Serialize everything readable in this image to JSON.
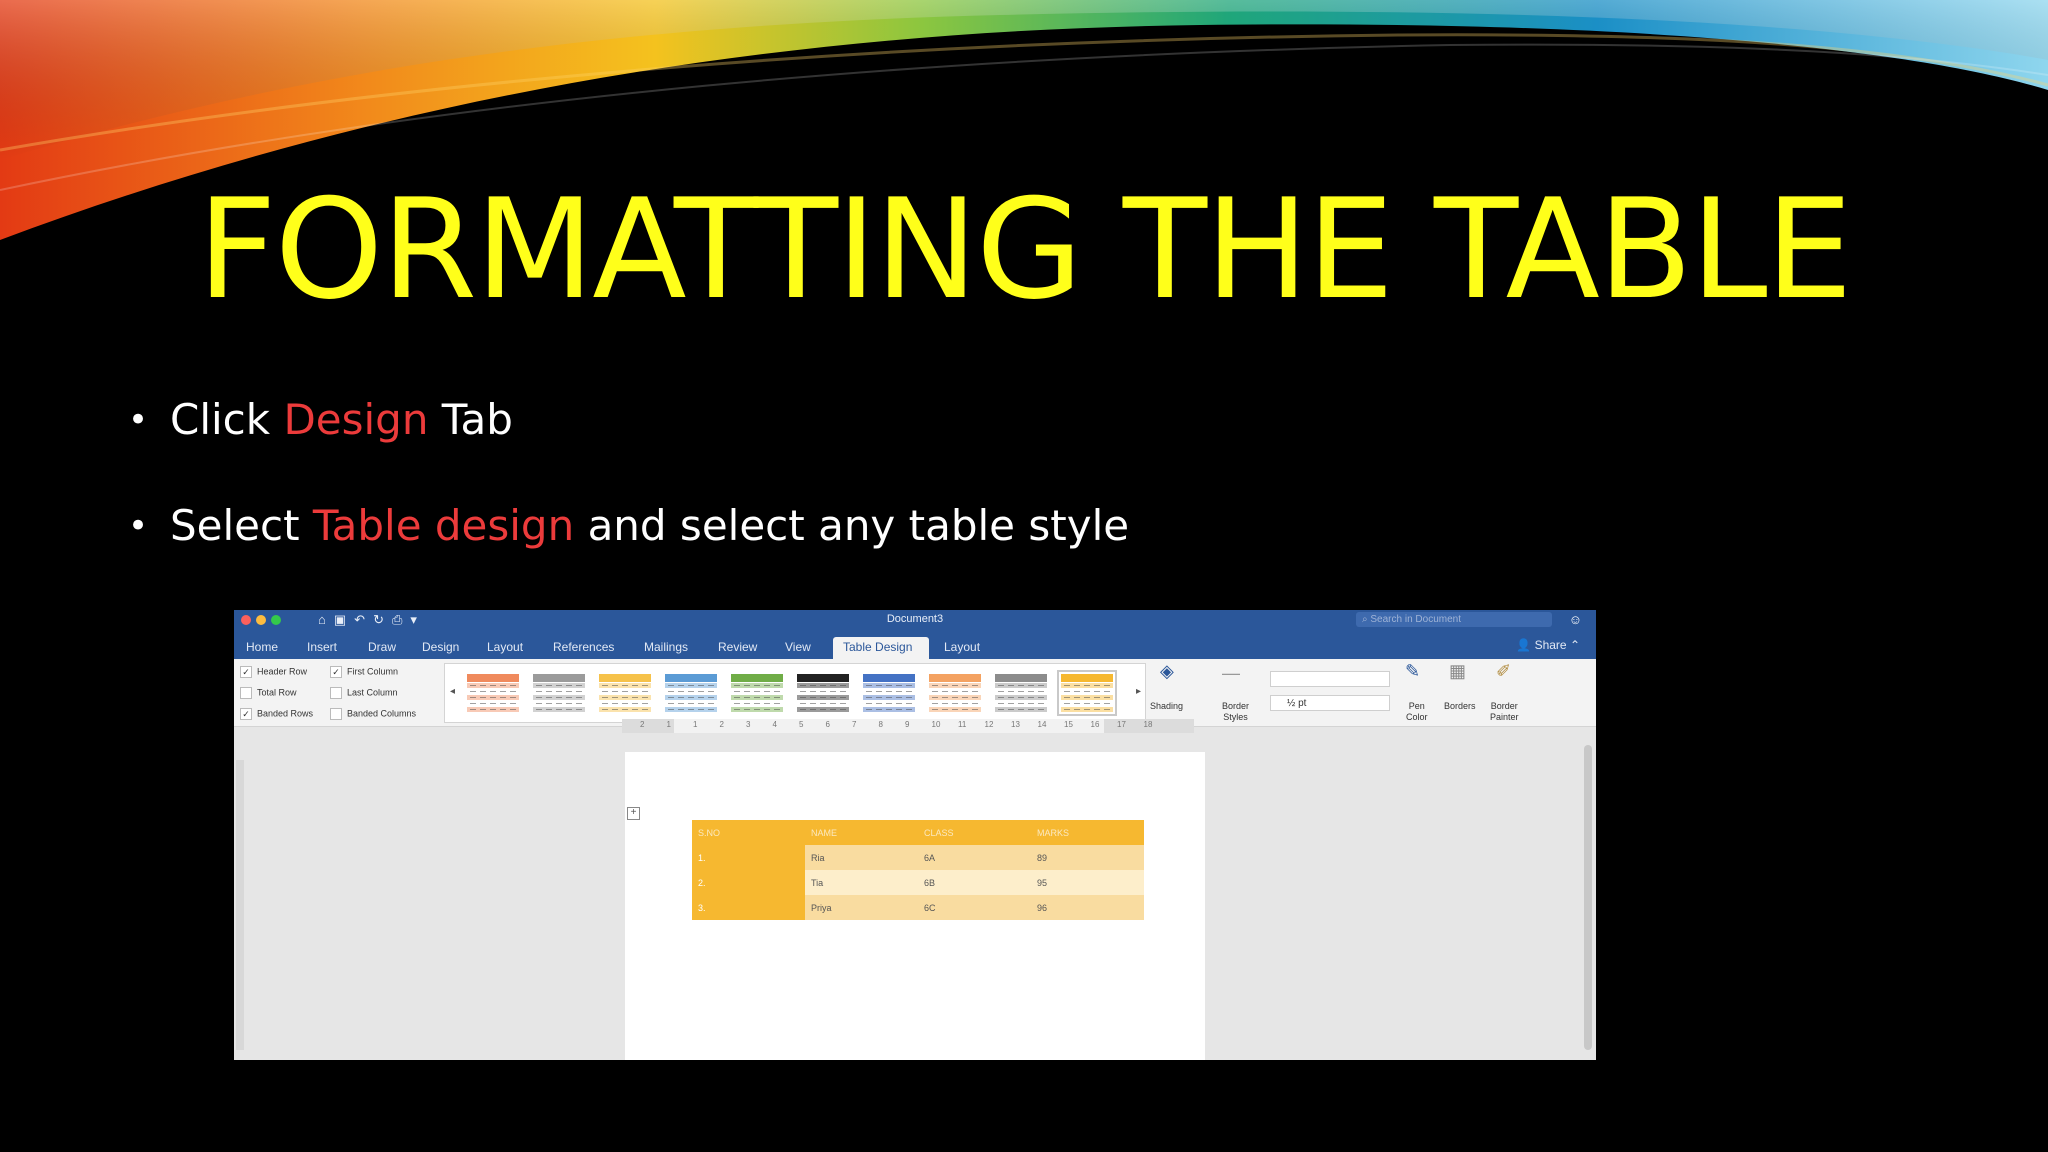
{
  "slide": {
    "title": "FORMATTING THE TABLE",
    "bullets": [
      {
        "pre": "Click ",
        "accent": "Design",
        "post": " Tab"
      },
      {
        "pre": "Select ",
        "accent": "Table design",
        "post": " and select any table style"
      }
    ],
    "accent_color": "#ec3b3b",
    "title_color": "#ffff1a"
  },
  "word": {
    "window_title": "Document3",
    "search_placeholder": "Search in Document",
    "tabs": [
      "Home",
      "Insert",
      "Draw",
      "Design",
      "Layout",
      "References",
      "Mailings",
      "Review",
      "View",
      "Table Design",
      "Layout"
    ],
    "active_tab": "Table Design",
    "share_label": "Share",
    "style_options": {
      "header_row": {
        "label": "Header Row",
        "checked": true
      },
      "total_row": {
        "label": "Total Row",
        "checked": false
      },
      "banded_rows": {
        "label": "Banded Rows",
        "checked": true
      },
      "first_column": {
        "label": "First Column",
        "checked": true
      },
      "last_column": {
        "label": "Last Column",
        "checked": false
      },
      "banded_columns": {
        "label": "Banded Columns",
        "checked": false
      }
    },
    "table_styles": [
      "#f08a5d",
      "#9b9b9b",
      "#f6c24a",
      "#5b9bd5",
      "#70ad47",
      "#222222",
      "#4472c4",
      "#f4a261",
      "#8c8c8c",
      "#f6b830"
    ],
    "selected_style_index": 9,
    "ribbon_buttons": {
      "shading": "Shading",
      "border_styles_1": "Border",
      "border_styles_2": "Styles",
      "pen_weight": "½ pt",
      "pen_color_1": "Pen",
      "pen_color_2": "Color",
      "borders": "Borders",
      "border_painter_1": "Border",
      "border_painter_2": "Painter"
    },
    "ruler_numbers": [
      "2",
      "1",
      "1",
      "2",
      "3",
      "4",
      "5",
      "6",
      "7",
      "8",
      "9",
      "10",
      "11",
      "12",
      "13",
      "14",
      "15",
      "16",
      "17",
      "18"
    ],
    "document_table": {
      "headers": [
        "S.NO",
        "NAME",
        "CLASS",
        "MARKS"
      ],
      "rows": [
        [
          "1.",
          "Ria",
          "6A",
          "89"
        ],
        [
          "2.",
          "Tia",
          "6B",
          "95"
        ],
        [
          "3.",
          "Priya",
          "6C",
          "96"
        ]
      ]
    }
  }
}
